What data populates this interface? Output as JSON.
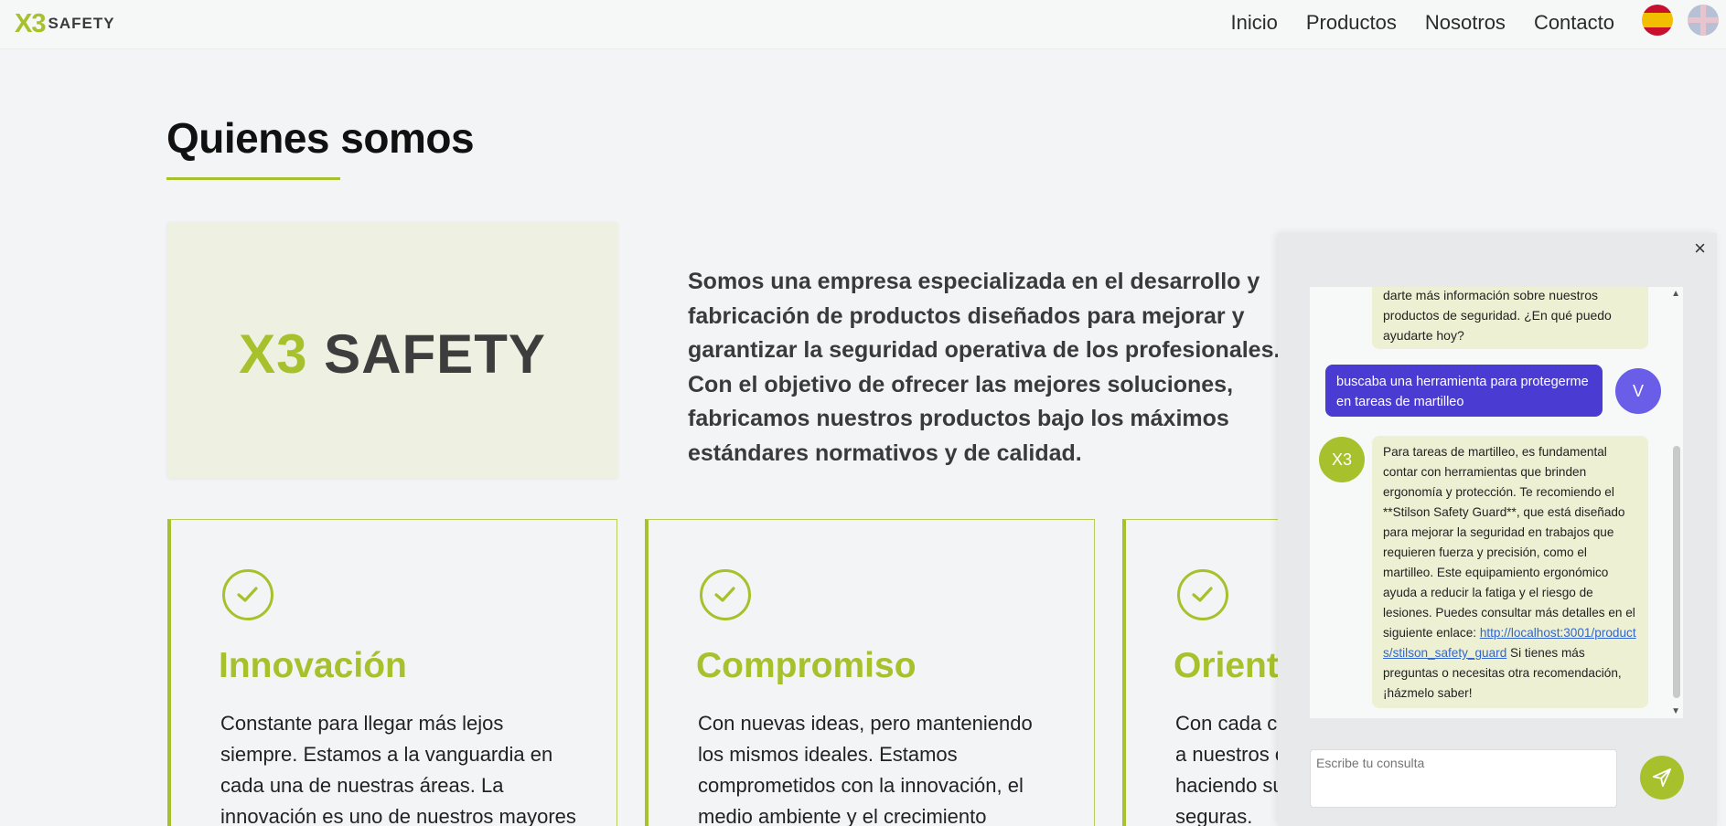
{
  "header": {
    "logo_x3": "X3",
    "logo_safety": "SAFETY",
    "nav": [
      "Inicio",
      "Productos",
      "Nosotros",
      "Contacto"
    ],
    "flags": [
      "spain-flag-icon",
      "uk-flag-icon"
    ]
  },
  "main": {
    "title": "Quienes somos",
    "panel_logo_x3": "X3",
    "panel_logo_safety": "SAFETY",
    "intro": "Somos una empresa especializada en el desarrollo y fabricación de productos diseñados para mejorar y garantizar la seguridad operativa de los profesionales. Con el objetivo de ofrecer las mejores soluciones, fabricamos nuestros productos bajo los máximos estándares normativos y de calidad.",
    "cards": [
      {
        "title": "Innovación",
        "text": "Constante para llegar más lejos siempre. Estamos a la vanguardia en cada una de nuestras áreas. La innovación es uno de nuestros mayores"
      },
      {
        "title": "Compromiso",
        "text": "Con nuevas ideas, pero manteniendo los mismos ideales. Estamos comprometidos con la innovación, el medio ambiente y el crecimiento"
      },
      {
        "title": "Orientación",
        "text": "Con cada como la industria. Ayudamos a nuestros clientes en su día a día haciendo sus operaciones más seguras."
      }
    ]
  },
  "chat": {
    "close_label": "×",
    "messages": [
      {
        "role": "bot",
        "text": "darte más información sobre nuestros productos de seguridad. ¿En qué puedo ayudarte hoy?"
      },
      {
        "role": "user",
        "text": "buscaba una herramienta para protegerme en tareas de martilleo"
      },
      {
        "role": "bot",
        "text": "Para tareas de martilleo, es fundamental contar con herramientas que brinden ergonomía y protección. Te recomiendo el **Stilson Safety Guard**, que está diseñado para mejorar la seguridad en trabajos que requieren fuerza y precisión, como el martilleo. Este equipamiento ergonómico ayuda a reducir la fatiga y el riesgo de lesiones. Puedes consultar más detalles en el siguiente enlace:",
        "link": "http://localhost:3001/products/stilson_safety_guard",
        "after": "Si tienes más preguntas o necesitas otra recomendación, ¡házmelo saber!"
      }
    ],
    "user_avatar": "V",
    "bot_avatar": "X3",
    "input_placeholder": "Escribe tu consulta"
  },
  "colors": {
    "accent": "#a6c12b",
    "user_bubble": "#4a3bd2",
    "bot_bubble": "#edf0d3"
  }
}
